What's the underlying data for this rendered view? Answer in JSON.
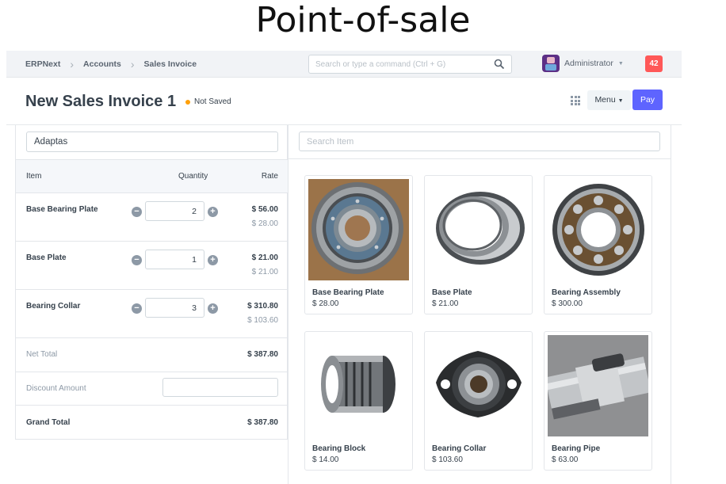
{
  "slide_title": "Point-of-sale",
  "breadcrumbs": [
    "ERPNext",
    "Accounts",
    "Sales Invoice"
  ],
  "search": {
    "placeholder": "Search or type a command (Ctrl + G)"
  },
  "user": {
    "name": "Administrator"
  },
  "notifications": {
    "count": "42"
  },
  "page": {
    "title": "New Sales Invoice 1",
    "status": "Not Saved",
    "menu_label": "Menu",
    "pay_label": "Pay"
  },
  "cart": {
    "customer": "Adaptas",
    "columns": {
      "item": "Item",
      "quantity": "Quantity",
      "rate": "Rate"
    },
    "rows": [
      {
        "name": "Base Bearing Plate",
        "qty": "2",
        "amount": "$ 56.00",
        "rate": "$ 28.00"
      },
      {
        "name": "Base Plate",
        "qty": "1",
        "amount": "$ 21.00",
        "rate": "$ 21.00"
      },
      {
        "name": "Bearing Collar",
        "qty": "3",
        "amount": "$ 310.80",
        "rate": "$ 103.60"
      }
    ],
    "net_total_label": "Net Total",
    "net_total": "$ 387.80",
    "discount_label": "Discount Amount",
    "grand_total_label": "Grand Total",
    "grand_total": "$ 387.80"
  },
  "items": {
    "search_placeholder": "Search Item",
    "list": [
      {
        "name": "Base Bearing Plate",
        "price": "$ 28.00",
        "image": "ball-bearing-image"
      },
      {
        "name": "Base Plate",
        "price": "$ 21.00",
        "image": "roller-bearing-image"
      },
      {
        "name": "Bearing Assembly",
        "price": "$ 300.00",
        "image": "self-aligning-bearing-image"
      },
      {
        "name": "Bearing Block",
        "price": "$ 14.00",
        "image": "needle-bearing-image"
      },
      {
        "name": "Bearing Collar",
        "price": "$ 103.60",
        "image": "flange-bearing-image"
      },
      {
        "name": "Bearing Pipe",
        "price": "$ 63.00",
        "image": "bottom-bracket-image"
      }
    ]
  },
  "colors": {
    "primary": "#5e64ff",
    "notification": "#ff5858",
    "status_dot": "#ffa00a"
  }
}
